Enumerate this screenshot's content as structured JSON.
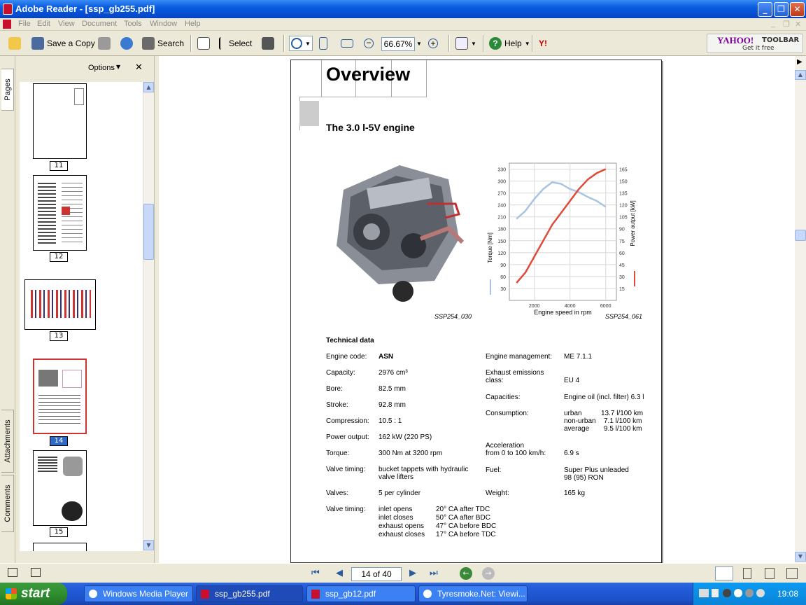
{
  "window": {
    "title": "Adobe Reader - [ssp_gb255.pdf]"
  },
  "menu": [
    "File",
    "Edit",
    "View",
    "Document",
    "Tools",
    "Window",
    "Help"
  ],
  "toolbar": {
    "save_copy": "Save a Copy",
    "search": "Search",
    "select": "Select",
    "zoom": "66.67%",
    "help": "Help",
    "yahoo_brand": "YAHOO!",
    "yahoo_toolbar": "TOOLBAR",
    "yahoo_getit": "Get it free"
  },
  "side_tabs": {
    "pages": "Pages",
    "attachments": "Attachments",
    "comments": "Comments"
  },
  "nav": {
    "options": "Options",
    "pages": [
      {
        "label": "11"
      },
      {
        "label": "12"
      },
      {
        "label": "13"
      },
      {
        "label": "14"
      },
      {
        "label": "15"
      }
    ]
  },
  "doc": {
    "heading": "Overview",
    "subheading": "The 3.0 l-5V engine",
    "caption_engine": "SSP254_030",
    "caption_chart": "SSP254_061",
    "tech_title": "Technical data",
    "left_rows": [
      {
        "label": "Engine code:",
        "value": "ASN"
      },
      {
        "label": "Capacity:",
        "value": "2976 cm³"
      },
      {
        "label": "Bore:",
        "value": "82.5 mm"
      },
      {
        "label": "Stroke:",
        "value": "92.8 mm"
      },
      {
        "label": "Compression:",
        "value": "10.5 : 1"
      },
      {
        "label": "Power output:",
        "value": "162 kW (220 PS)"
      },
      {
        "label": "Torque:",
        "value": "300 Nm at 3200 rpm"
      },
      {
        "label": "Valve timing:",
        "value": "bucket tappets with hydraulic",
        "value2": "valve lifters"
      },
      {
        "label": "Valves:",
        "value": "5 per cylinder"
      }
    ],
    "valve_timing_label": "Valve timing:",
    "valve_events": [
      {
        "event": "inlet opens",
        "angle": "20° CA after TDC"
      },
      {
        "event": "inlet closes",
        "angle": "50° CA after BDC"
      },
      {
        "event": "exhaust opens",
        "angle": "47° CA before BDC"
      },
      {
        "event": "exhaust closes",
        "angle": "17° CA before TDC"
      }
    ],
    "right_rows": [
      {
        "label": "Engine management:",
        "value": "ME 7.1.1"
      },
      {
        "label": "Exhaust emissions",
        "label2": "class:",
        "value": "EU 4"
      },
      {
        "label": "Capacities:",
        "value": "Engine oil (incl. filter) 6.3 l"
      },
      {
        "label": "Consumption:",
        "value": ""
      },
      {
        "label": "Acceleration",
        "label2": "from 0 to 100 km/h:",
        "value": "6.9 s"
      },
      {
        "label": "Fuel:",
        "value": "Super Plus unleaded",
        "value2": "98 (95) RON"
      },
      {
        "label": "Weight:",
        "value": "165 kg"
      }
    ],
    "consumption": [
      {
        "kind": "urban",
        "value": "13.7 l/100 km"
      },
      {
        "kind": "non-urban",
        "value": "7.1 l/100 km"
      },
      {
        "kind": "average",
        "value": "9.5 l/100 km"
      }
    ]
  },
  "chart_data": {
    "type": "line",
    "xlabel": "Engine speed in rpm",
    "ylabel": "Torque [Nm]",
    "y2label": "Power output [kW]",
    "x_ticks": [
      "2000",
      "4000",
      "6000"
    ],
    "xlim": [
      600,
      6600
    ],
    "y_ticks": [
      "30",
      "60",
      "90",
      "120",
      "150",
      "180",
      "210",
      "240",
      "270",
      "300",
      "330"
    ],
    "ylim": [
      0,
      345
    ],
    "y2_ticks": [
      "15",
      "30",
      "45",
      "60",
      "75",
      "90",
      "105",
      "120",
      "135",
      "150",
      "165"
    ],
    "y2lim": [
      0,
      172.5
    ],
    "series": [
      {
        "color": "#a8c4e0",
        "axis": "left",
        "x": [
          1000,
          1500,
          2000,
          2500,
          3000,
          3500,
          4000,
          4500,
          5000,
          5500,
          6000
        ],
        "y": [
          205,
          225,
          255,
          280,
          297,
          293,
          280,
          272,
          260,
          250,
          235
        ]
      },
      {
        "color": "#e04a3a",
        "axis": "right",
        "x": [
          1000,
          1500,
          2000,
          2500,
          3000,
          3500,
          4000,
          4500,
          5000,
          5500,
          6000
        ],
        "y": [
          22,
          35,
          55,
          75,
          95,
          110,
          125,
          140,
          152,
          160,
          165
        ]
      }
    ]
  },
  "status": {
    "page_box": "14 of 40"
  },
  "taskbar": {
    "start": "start",
    "tasks": [
      "Windows Media Player",
      "ssp_gb255.pdf",
      "ssp_gb12.pdf",
      "Tyresmoke.Net: Viewi..."
    ],
    "clock": "19:08"
  }
}
